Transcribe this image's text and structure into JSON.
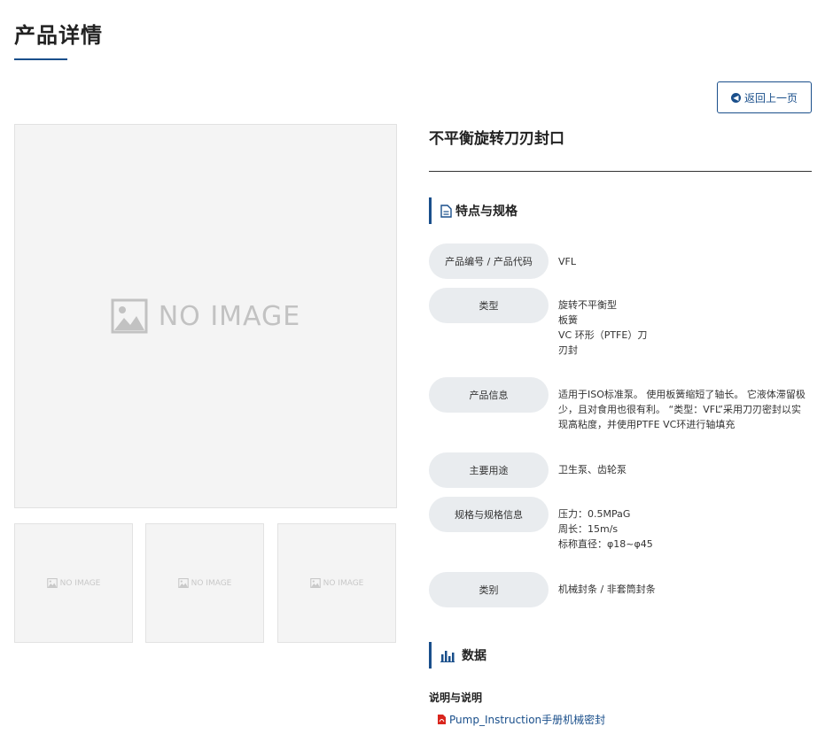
{
  "page": {
    "title": "产品详情"
  },
  "back_button": {
    "label": "返回上一页"
  },
  "gallery": {
    "main_placeholder": "NO IMAGE",
    "thumbs": [
      "NO IMAGE",
      "NO IMAGE",
      "NO IMAGE"
    ]
  },
  "product": {
    "name": "不平衡旋转刀刃封口"
  },
  "specs_section": {
    "title": "特点与规格"
  },
  "specs": [
    {
      "label": "产品编号 / 产品代码",
      "lines": [
        "VFL"
      ]
    },
    {
      "label": "类型",
      "lines": [
        "旋转不平衡型",
        "板簧",
        "VC 环形（PTFE）刀",
        "刃封"
      ]
    },
    {
      "label": "产品信息",
      "lines": [
        "适用于ISO标准泵。 使用板簧缩短了轴长。 它液体滞留极",
        "少，且对食用也很有利。 “类型：VFL”采用刀刃密封以实",
        "现高粘度，并使用PTFE VC环进行轴填充"
      ]
    },
    {
      "label": "主要用途",
      "lines": [
        "卫生泵、齿轮泵"
      ]
    },
    {
      "label": "规格与规格信息",
      "lines": [
        "压力：0.5MPaG",
        "周长：15m/s",
        "标称直径：φ18~φ45"
      ]
    },
    {
      "label": "类别",
      "lines": [
        "机械封条 / 非套筒封条"
      ]
    }
  ],
  "data_section": {
    "title": "数据"
  },
  "documents": {
    "heading": "说明与说明",
    "links": [
      "Pump_Instruction手册机械密封"
    ]
  },
  "colors": {
    "accent": "#1a4f8b",
    "pill": "#e9ecef",
    "placeholder": "#f4f4f4",
    "pdf": "#d9251d"
  }
}
